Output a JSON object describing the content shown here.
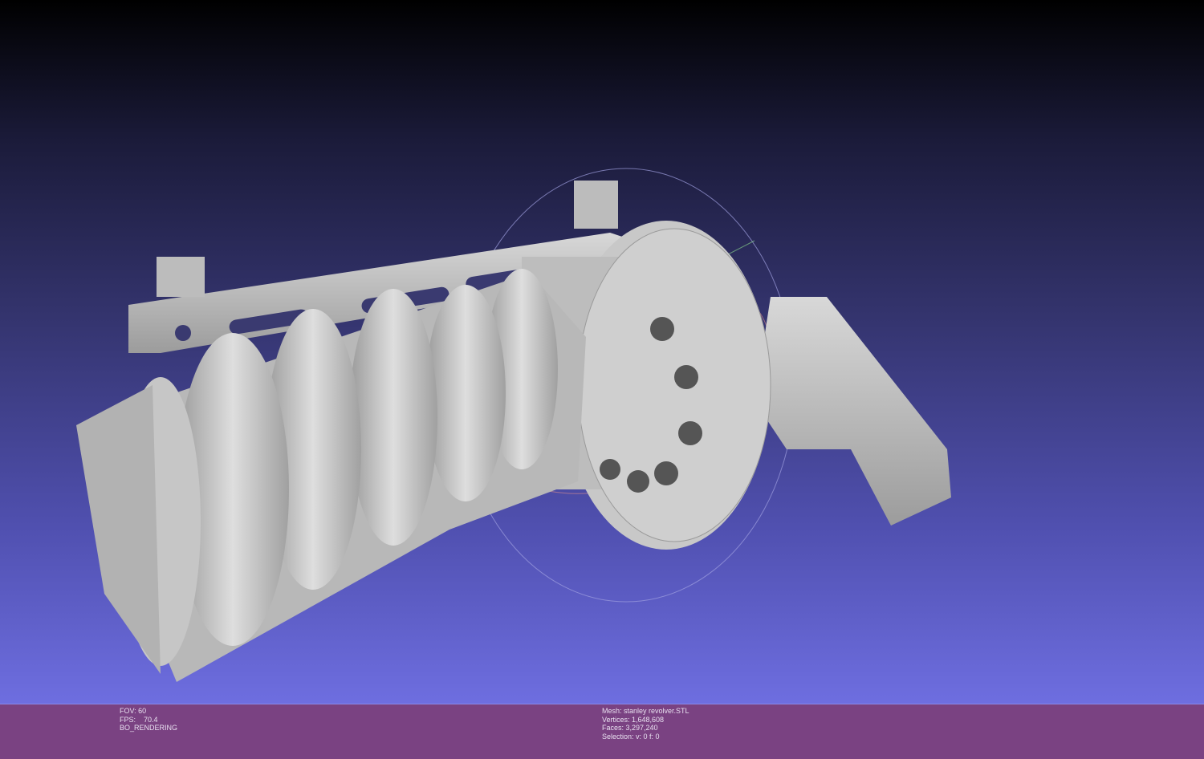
{
  "viewport": {
    "label": "3D mesh view"
  },
  "status_left": {
    "fov": "FOV: 60",
    "fps": "FPS:    70.4",
    "mode": "BO_RENDERING"
  },
  "status_right": {
    "mesh": "Mesh: stanley revolver.STL",
    "vertices": "Vertices: 1,648,608",
    "faces": "Faces: 3,297,240",
    "selection": "Selection: v: 0 f: 0"
  },
  "colors": {
    "statusbar": "#7a4282",
    "mesh": "#c4c4c4"
  }
}
